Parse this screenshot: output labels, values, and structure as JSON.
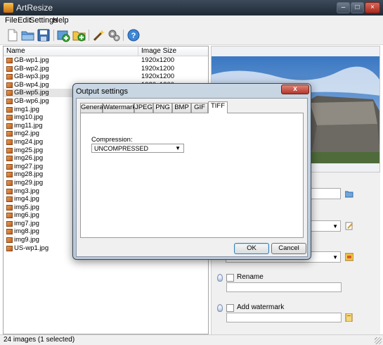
{
  "window": {
    "title": "ArtResize",
    "min_label": "–",
    "max_label": "□",
    "close_label": "×"
  },
  "menu": [
    "File",
    "Edit",
    "Settings",
    "Help"
  ],
  "toolbar": {
    "icons": [
      "new-file-icon",
      "open-folder-icon",
      "save-icon",
      "add-images-icon",
      "add-folder-icon",
      "wand-icon",
      "gears-icon",
      "help-icon"
    ]
  },
  "list": {
    "columns": {
      "name": "Name",
      "size": "Image Size"
    },
    "rows": [
      {
        "name": "GB-wp1.jpg",
        "size": "1920x1200"
      },
      {
        "name": "GB-wp2.jpg",
        "size": "1920x1200"
      },
      {
        "name": "GB-wp3.jpg",
        "size": "1920x1200"
      },
      {
        "name": "GB-wp4.jpg",
        "size": "1920x1200"
      },
      {
        "name": "GB-wp5.jpg",
        "size": ""
      },
      {
        "name": "GB-wp6.jpg",
        "size": ""
      },
      {
        "name": "img1.jpg",
        "size": ""
      },
      {
        "name": "img10.jpg",
        "size": ""
      },
      {
        "name": "img11.jpg",
        "size": ""
      },
      {
        "name": "img2.jpg",
        "size": ""
      },
      {
        "name": "img24.jpg",
        "size": ""
      },
      {
        "name": "img25.jpg",
        "size": ""
      },
      {
        "name": "img26.jpg",
        "size": ""
      },
      {
        "name": "img27.jpg",
        "size": ""
      },
      {
        "name": "img28.jpg",
        "size": ""
      },
      {
        "name": "img29.jpg",
        "size": ""
      },
      {
        "name": "img3.jpg",
        "size": ""
      },
      {
        "name": "img4.jpg",
        "size": ""
      },
      {
        "name": "img5.jpg",
        "size": ""
      },
      {
        "name": "img6.jpg",
        "size": ""
      },
      {
        "name": "img7.jpg",
        "size": ""
      },
      {
        "name": "img8.jpg",
        "size": ""
      },
      {
        "name": "img9.jpg",
        "size": ""
      },
      {
        "name": "US-wp1.jpg",
        "size": ""
      }
    ]
  },
  "options": {
    "rename_label": "Rename",
    "watermark_label": "Add watermark"
  },
  "status": {
    "text": "24 images (1 selected)"
  },
  "dialog": {
    "title": "Output settings",
    "close_label": "x",
    "tabs": [
      "General",
      "Watermark",
      "JPEG",
      "PNG",
      "BMP",
      "GIF",
      "TIFF"
    ],
    "active_tab": "TIFF",
    "compression_label": "Compression:",
    "compression_value": "UNCOMPRESSED",
    "ok_label": "OK",
    "cancel_label": "Cancel"
  }
}
